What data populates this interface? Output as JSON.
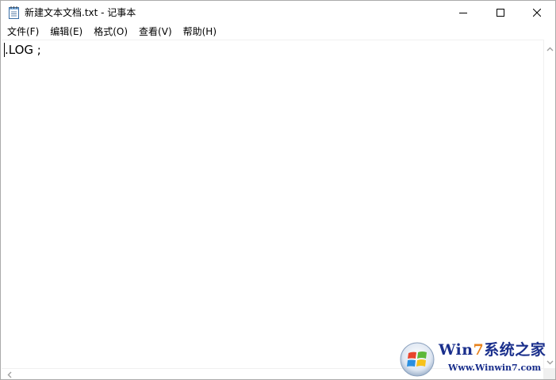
{
  "window": {
    "title": "新建文本文档.txt - 记事本",
    "app_icon": "notepad-icon",
    "caption_buttons": [
      "minimize-icon",
      "maximize-icon",
      "close-icon"
    ]
  },
  "menu": {
    "items": [
      "文件(F)",
      "编辑(E)",
      "格式(O)",
      "查看(V)",
      "帮助(H)"
    ]
  },
  "editor": {
    "content": ".LOG ;"
  },
  "scrollbars": {
    "icons": [
      "scroll-up-arrow-icon",
      "scroll-down-arrow-icon",
      "scroll-left-arrow-icon"
    ]
  },
  "watermark": {
    "brand_prefix": "Win",
    "brand_seven": "7",
    "brand_suffix": "系统之家",
    "url": "Www.Winwin7.com",
    "logo": "windows-logo-icon",
    "colors": {
      "brand": "#1a2f8c",
      "seven": "#e8821c"
    }
  }
}
